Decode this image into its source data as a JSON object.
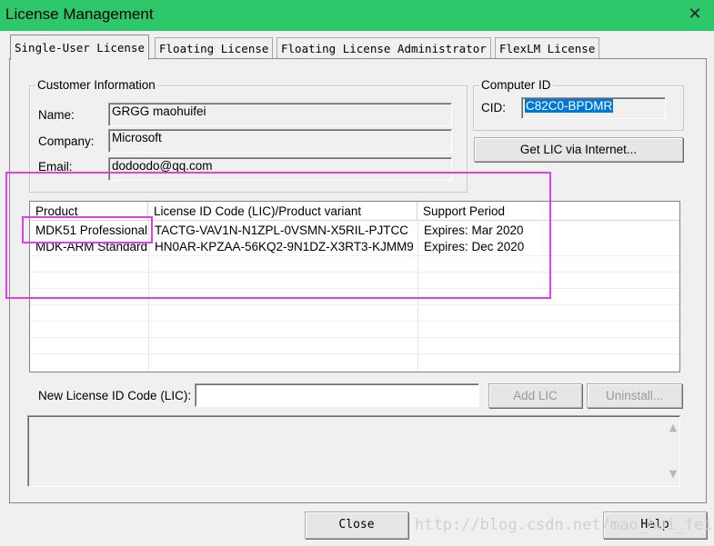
{
  "window": {
    "title": "License Management",
    "close_glyph": "✕"
  },
  "tabs": [
    {
      "label": "Single-User License",
      "active": true
    },
    {
      "label": "Floating License",
      "active": false
    },
    {
      "label": "Floating License Administrator",
      "active": false
    },
    {
      "label": "FlexLM License",
      "active": false
    }
  ],
  "customer_info": {
    "label": "Customer Information",
    "name_label": "Name:",
    "name_value": "GRGG maohuifei",
    "company_label": "Company:",
    "company_value": "Microsoft",
    "email_label": "Email:",
    "email_value": "dodoodo@qq.com"
  },
  "computer_id": {
    "label": "Computer ID",
    "cid_label": "CID:",
    "cid_value": "C82C0-BPDMR",
    "get_lic_button": "Get LIC via Internet..."
  },
  "license_table": {
    "columns": [
      "Product",
      "License ID Code (LIC)/Product variant",
      "Support Period"
    ],
    "rows": [
      {
        "product": "MDK51 Professional",
        "lic": "TACTG-VAV1N-N1ZPL-0VSMN-X5RIL-PJTCC",
        "support": "Expires: Mar 2020"
      },
      {
        "product": "MDK-ARM Standard",
        "lic": "HN0AR-KPZAA-56KQ2-9N1DZ-X3RT3-KJMM9",
        "support": "Expires: Dec 2020"
      }
    ]
  },
  "new_lic": {
    "label": "New License ID Code (LIC):",
    "value": "",
    "add_button": "Add LIC",
    "uninstall_button": "Uninstall..."
  },
  "footer": {
    "close_button": "Close",
    "help_button": "Help",
    "watermark": "http://blog.csdn.net/mao_hui_fei"
  },
  "colors": {
    "titlebar": "#2ec86a",
    "highlight": "#e040e8",
    "cid_selection": "#0078d7"
  }
}
